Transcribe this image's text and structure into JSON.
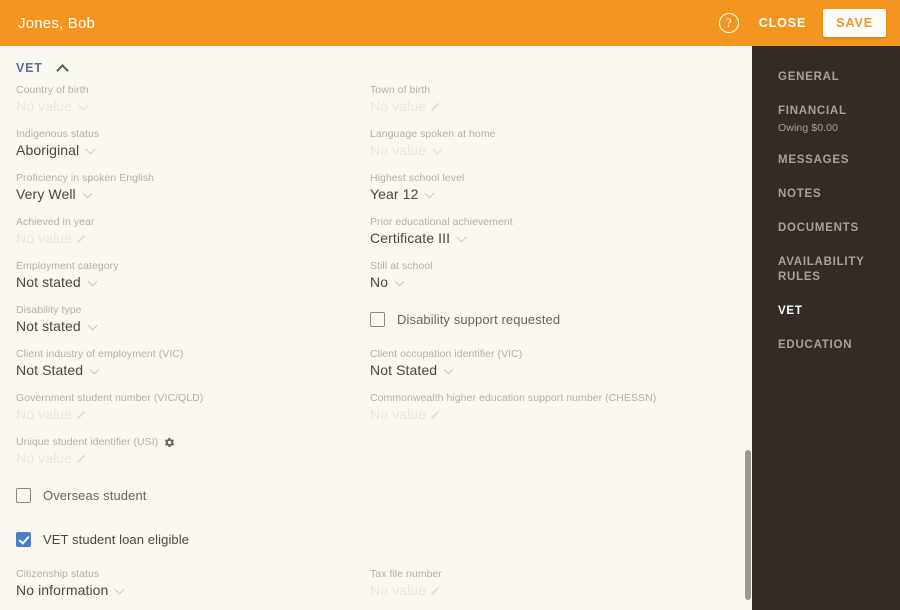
{
  "header": {
    "title": "Jones, Bob",
    "help_icon": "help-circle-icon",
    "close_label": "CLOSE",
    "save_label": "SAVE",
    "background_color": "#F3951F"
  },
  "sidebar": {
    "background_color": "#332B25",
    "items": [
      {
        "label": "GENERAL",
        "active": false
      },
      {
        "label": "FINANCIAL",
        "active": false,
        "sub": "Owing $0.00"
      },
      {
        "label": "MESSAGES",
        "active": false
      },
      {
        "label": "NOTES",
        "active": false
      },
      {
        "label": "DOCUMENTS",
        "active": false
      },
      {
        "label": "AVAILABILITY RULES",
        "active": false
      },
      {
        "label": "VET",
        "active": true
      },
      {
        "label": "EDUCATION",
        "active": false
      }
    ]
  },
  "section": {
    "title": "VET",
    "collapse_icon": "chevron-up-icon",
    "accent_color": "#5A6E97"
  },
  "form": {
    "left_column": [
      {
        "type": "field",
        "label": "Country of birth",
        "value": "No value",
        "empty": true,
        "icon": "chevron-down-icon"
      },
      {
        "type": "field",
        "label": "Indigenous status",
        "value": "Aboriginal",
        "empty": false,
        "icon": "chevron-down-icon"
      },
      {
        "type": "field",
        "label": "Proficiency in spoken English",
        "value": "Very Well",
        "empty": false,
        "icon": "chevron-down-icon"
      },
      {
        "type": "field",
        "label": "Achieved in year",
        "value": "No value",
        "empty": true,
        "icon": "pencil-icon"
      },
      {
        "type": "field",
        "label": "Employment category",
        "value": "Not stated",
        "empty": false,
        "icon": "chevron-down-icon"
      },
      {
        "type": "field",
        "label": "Disability type",
        "value": "Not stated",
        "empty": false,
        "icon": "chevron-down-icon"
      },
      {
        "type": "field",
        "label": "Client industry of employment (VIC)",
        "value": "Not Stated",
        "empty": false,
        "icon": "chevron-down-icon"
      },
      {
        "type": "field",
        "label": "Government student number (VIC/QLD)",
        "value": "No value",
        "empty": true,
        "icon": "pencil-icon"
      },
      {
        "type": "field",
        "label": "Unique student identifier (USI)",
        "value": "No value",
        "empty": true,
        "icon": "pencil-icon",
        "label_icon": "gear-icon"
      },
      {
        "type": "checkbox",
        "label": "Overseas student",
        "checked": false
      },
      {
        "type": "checkbox",
        "label": "VET student loan eligible",
        "checked": true
      },
      {
        "type": "field",
        "label": "Citizenship status",
        "value": "No information",
        "empty": false,
        "icon": "chevron-down-icon"
      }
    ],
    "right_column": [
      {
        "type": "field",
        "label": "Town of birth",
        "value": "No value",
        "empty": true,
        "icon": "pencil-icon"
      },
      {
        "type": "field",
        "label": "Language spoken at home",
        "value": "No value",
        "empty": true,
        "icon": "chevron-down-icon"
      },
      {
        "type": "field",
        "label": "Highest school level",
        "value": "Year 12",
        "empty": false,
        "icon": "chevron-down-icon"
      },
      {
        "type": "field",
        "label": "Prior educational achievement",
        "value": "Certificate III",
        "empty": false,
        "icon": "chevron-down-icon"
      },
      {
        "type": "field",
        "label": "Still at school",
        "value": "No",
        "empty": false,
        "icon": "chevron-down-icon"
      },
      {
        "type": "checkbox",
        "label": "Disability support requested",
        "checked": false
      },
      {
        "type": "field",
        "label": "Client occupation identifier (VIC)",
        "value": "Not Stated",
        "empty": false,
        "icon": "chevron-down-icon"
      },
      {
        "type": "field",
        "label": "Commonwealth higher education support number (CHESSN)",
        "value": "No value",
        "empty": true,
        "icon": "pencil-icon"
      },
      {
        "type": "spacer"
      },
      {
        "type": "spacer"
      },
      {
        "type": "spacer"
      },
      {
        "type": "field",
        "label": "Tax file number",
        "value": "No value",
        "empty": true,
        "icon": "pencil-icon"
      }
    ]
  }
}
